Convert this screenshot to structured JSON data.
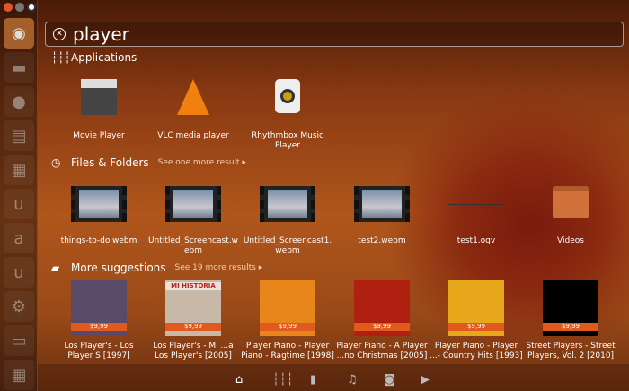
{
  "window_controls": [
    "close",
    "minimize",
    "maximize"
  ],
  "launcher": {
    "items": [
      "ubuntu-logo",
      "folder",
      "firefox",
      "document",
      "files",
      "ubuntu-one",
      "amazon",
      "ubuntu-software",
      "settings",
      "terminal",
      "workspaces"
    ]
  },
  "search": {
    "value": "player"
  },
  "applications": {
    "title": "Applications",
    "items": [
      {
        "label": "Movie Player"
      },
      {
        "label": "VLC media player"
      },
      {
        "label": "Rhythmbox Music Player"
      }
    ]
  },
  "files": {
    "title": "Files & Folders",
    "more": "See one more result",
    "items": [
      {
        "label": "things-to-do.webm"
      },
      {
        "label": "Untitled_Screencast.webm"
      },
      {
        "label": "Untitled_Screencast1.webm"
      },
      {
        "label": "test2.webm"
      },
      {
        "label": "test1.ogv"
      },
      {
        "label": "Videos"
      }
    ]
  },
  "suggestions": {
    "title": "More suggestions",
    "more": "See 19 more results",
    "items": [
      {
        "label": "Los Player's - Los Player S [1997]",
        "price": "$9,99",
        "color": "#5a4a6a"
      },
      {
        "label": "Los Player's - Mi ...a Los Player's [2005]",
        "price": "$9,99",
        "color": "#c8b8a8",
        "cover_text": "MI HISTORIA"
      },
      {
        "label": "Player Piano - Player Piano - Ragtime [1998]",
        "price": "$9,99",
        "color": "#e8861c"
      },
      {
        "label": "Player Piano - A Player ...no Christmas [2005]",
        "price": "$9,99",
        "color": "#b02010"
      },
      {
        "label": "Player Piano - Player ...- Country Hits [1993]",
        "price": "$9,99",
        "color": "#e8a81c"
      },
      {
        "label": "Street Players - Street Players, Vol. 2 [2010]",
        "price": "$9,99",
        "color": "#000000"
      }
    ]
  },
  "lenses": [
    "home",
    "applications",
    "files",
    "music",
    "photos",
    "video"
  ]
}
